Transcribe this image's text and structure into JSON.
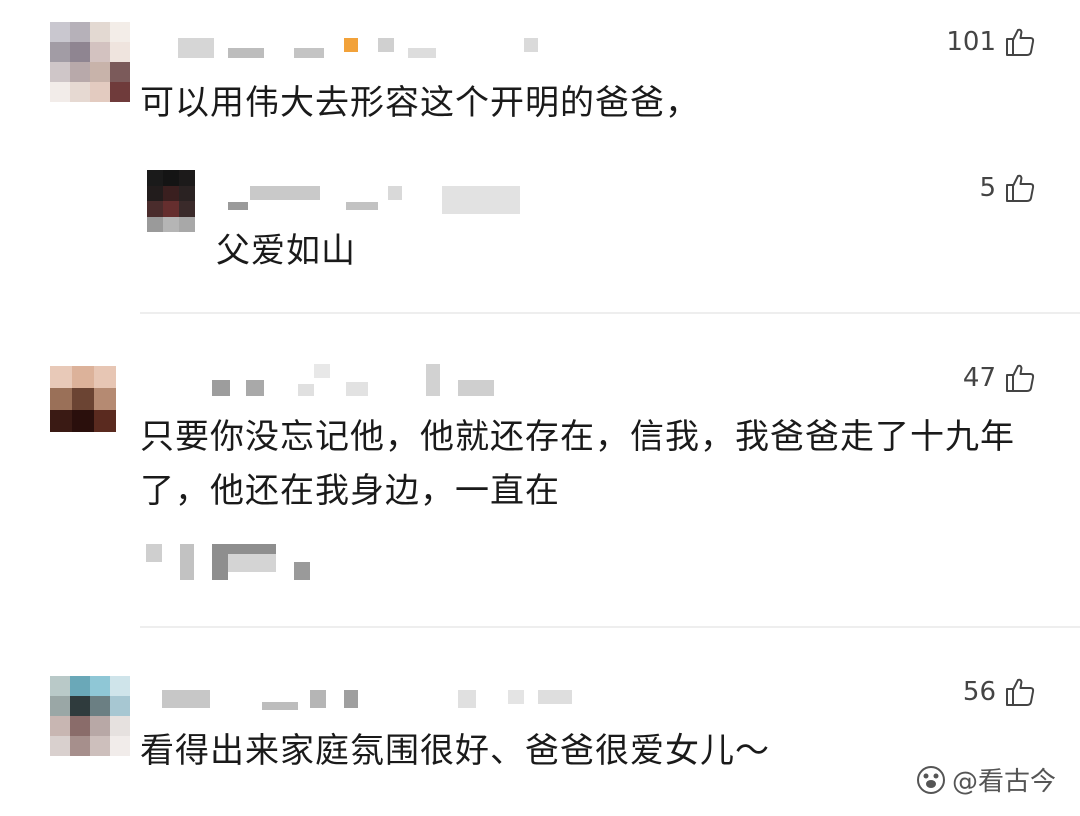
{
  "comments": [
    {
      "text": "可以用伟大去形容这个开明的爸爸，",
      "likes": "101",
      "username": "",
      "reply": {
        "text": "父爱如山",
        "likes": "5",
        "username": ""
      }
    },
    {
      "text": "只要你没忘记他，他就还存在，信我，我爸爸走了十九年了，他还在我身边，一直在",
      "likes": "47",
      "username": ""
    },
    {
      "text": "看得出来家庭氛围很好、爸爸很爱女儿～",
      "likes": "56",
      "username": ""
    }
  ],
  "watermark": {
    "text": "@看古今",
    "icon": "paw-logo-icon"
  },
  "icons": {
    "like": "thumbs-up-icon"
  }
}
